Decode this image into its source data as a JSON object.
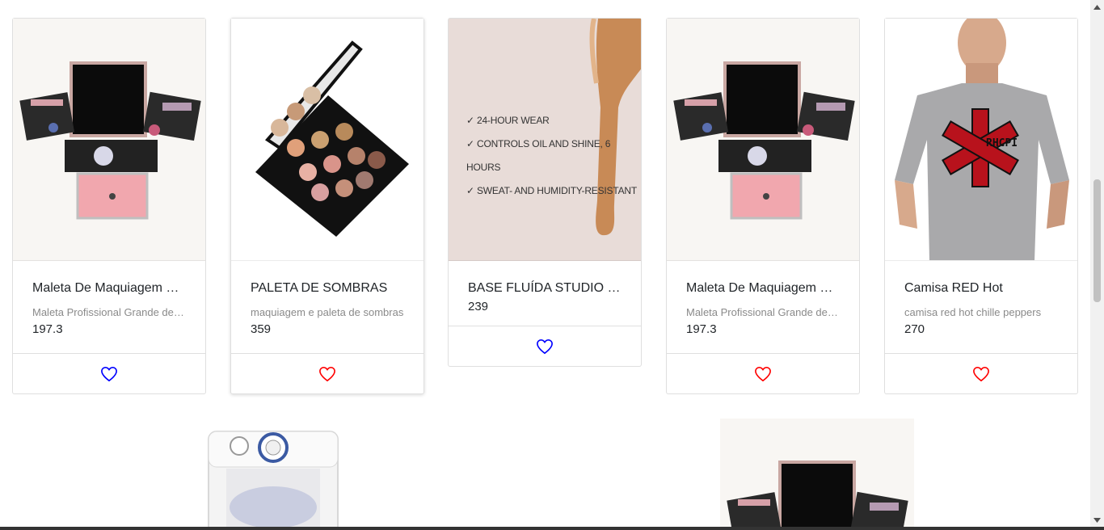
{
  "products": [
    {
      "title": "Maleta De Maquiagem Profissional",
      "description": "Maleta Profissional Grande de Maquiagem",
      "price": "197.3",
      "favorite_style": "blue",
      "image": "makeup-case-image"
    },
    {
      "title": "PALETA DE SOMBRAS",
      "description": "maquiagem e paleta de sombras",
      "price": "359",
      "favorite_style": "red",
      "image": "eyeshadow-palette-image"
    },
    {
      "title": "BASE FLUÍDA STUDIO FIX",
      "description": "",
      "price": "239",
      "favorite_style": "blue",
      "image": "foundation-image",
      "image_text": [
        "✓ 24-HOUR WEAR",
        "✓ CONTROLS OIL AND SHINE, 6 HOURS",
        "✓ SWEAT- AND HUMIDITY-RESISTANT"
      ]
    },
    {
      "title": "Maleta De Maquiagem Profissional",
      "description": "Maleta Profissional Grande de Maquiagem",
      "price": "197.3",
      "favorite_style": "red",
      "image": "makeup-case-image"
    },
    {
      "title": "Camisa RED Hot",
      "description": "camisa red hot chille peppers",
      "price": "270",
      "favorite_style": "red",
      "image": "tshirt-image",
      "image_text": [
        "RHCPI"
      ]
    }
  ],
  "colors": {
    "heart_blue": "#0000ff",
    "heart_red": "#ff0000"
  }
}
